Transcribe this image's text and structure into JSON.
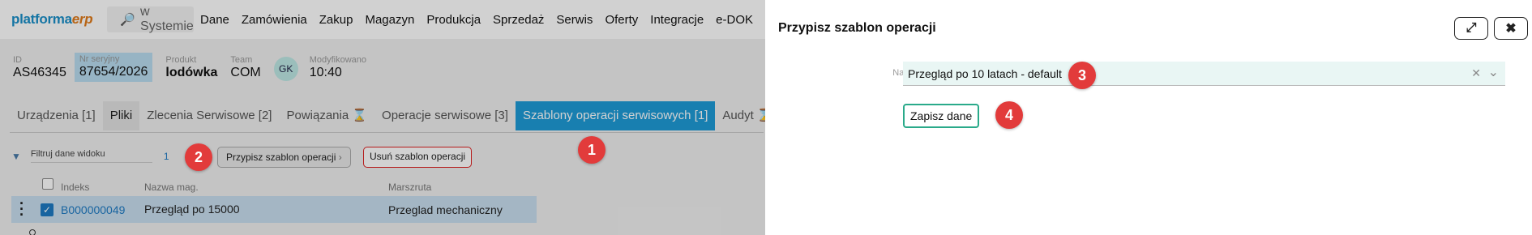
{
  "topbar": {
    "logo_main": "platforma",
    "logo_accent": "erp",
    "search_label": "w Systemie",
    "nav": [
      "Dane",
      "Zamówienia",
      "Zakup",
      "Magazyn",
      "Produkcja",
      "Sprzedaż",
      "Serwis",
      "Oferty",
      "Integracje",
      "e-DOK"
    ]
  },
  "record": {
    "id_label": "ID",
    "id_value": "AS46345",
    "serial_label": "Nr seryjny",
    "serial_value": "87654/2026",
    "product_label": "Produkt",
    "product_value": "lodówka",
    "team_label": "Team",
    "team_value": "COM",
    "avatar_initials": "GK",
    "modified_label": "Modyfikowano",
    "modified_value": "10:40"
  },
  "tabs": [
    "Urządzenia [1]",
    "Pliki",
    "Zlecenia Serwisowe [2]",
    "Powiązania ⌛",
    "Operacje serwisowe [3]",
    "Szablony operacji serwisowych [1]",
    "Audyt ⌛"
  ],
  "toolbar": {
    "filter_placeholder": "Filtruj dane widoku",
    "count": "1",
    "assign_label": "Przypisz szablon operacji",
    "delete_label": "Usuń szablon operacji"
  },
  "table": {
    "columns": [
      "Indeks",
      "Nazwa mag.",
      "Marszruta"
    ],
    "rows": [
      {
        "index": "B000000049",
        "name": "Przegląd po 15000",
        "route": "Przeglad mechaniczny"
      }
    ]
  },
  "panel": {
    "title": "Przypisz szablon operacji",
    "field_label": "Nazwa szablonu",
    "field_value": "Przegląd po 10 latach - default",
    "save_label": "Zapisz dane"
  },
  "markers": [
    "1",
    "2",
    "3",
    "4"
  ],
  "colors": {
    "accent": "#1e9bd7",
    "marker": "#e23b3b",
    "save_border": "#2aaa8a",
    "delete_border": "#dd2222"
  }
}
